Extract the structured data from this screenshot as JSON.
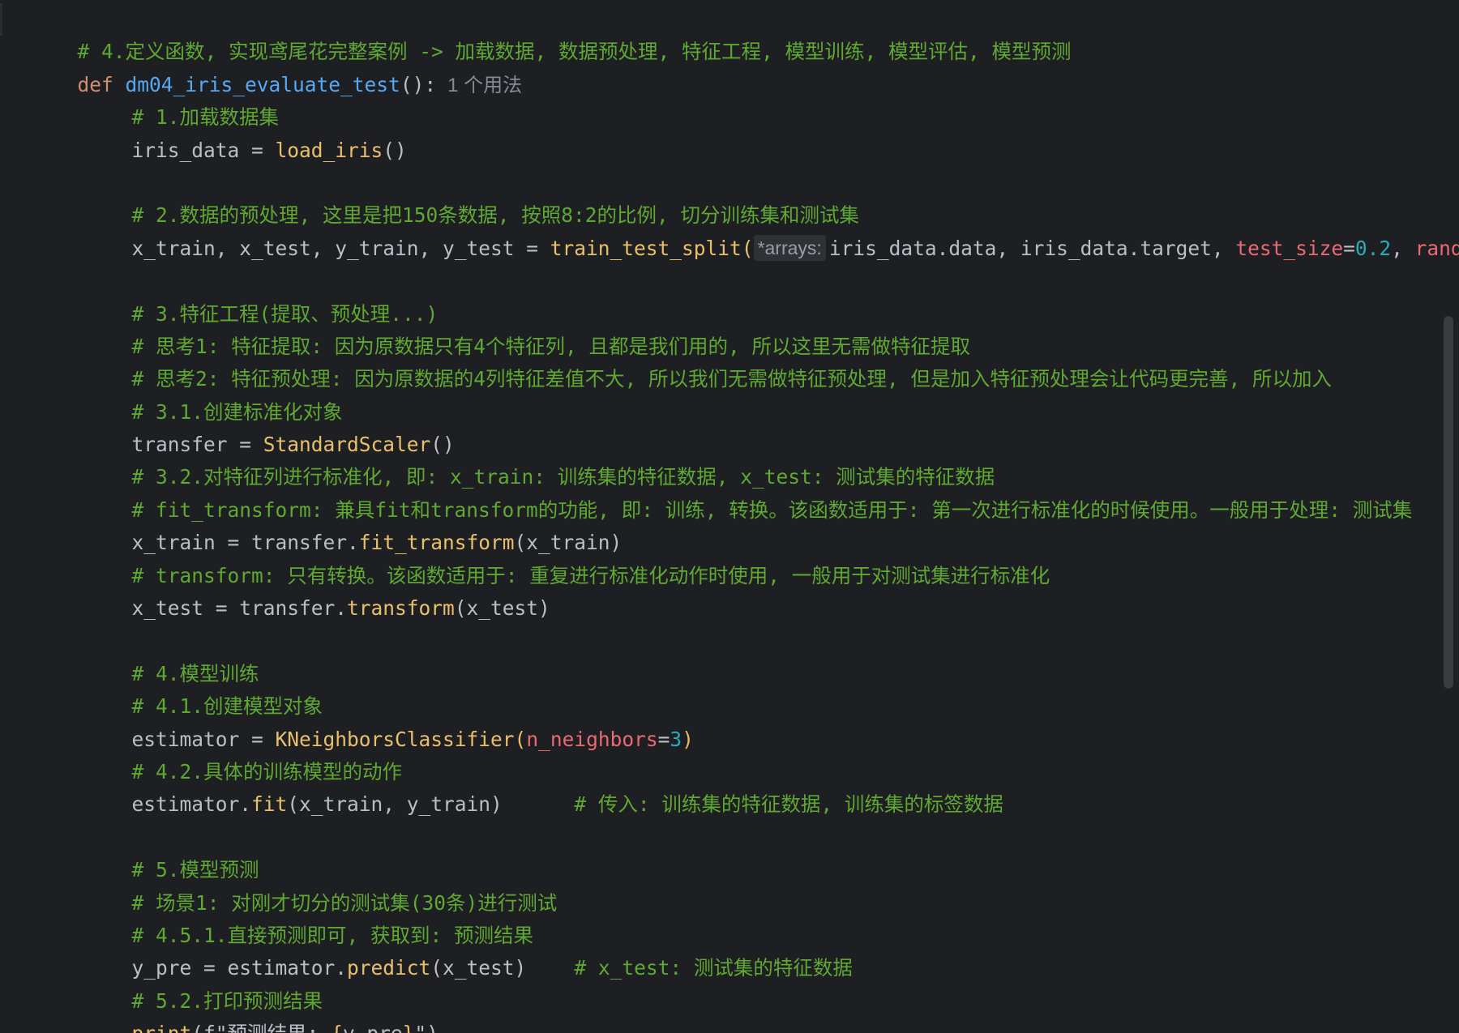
{
  "editor": {
    "language": "Python",
    "theme_colors": {
      "background": "#1e1f22",
      "comment": "#5fa832",
      "keyword": "#cf8e6d",
      "function": "#56a8f5",
      "call": "#e8c06b",
      "parameter": "#e96a72",
      "number": "#2aacb8",
      "text": "#bcbec4"
    },
    "lines": {
      "l1": "# 4.定义函数, 实现鸢尾花完整案例 -> 加载数据, 数据预处理, 特征工程, 模型训练, 模型评估, 模型预测",
      "l2_kw": "def",
      "l2_name": "dm04_iris_evaluate_test",
      "l2_tail": "():",
      "l2_usage": "1 个用法",
      "l3": "# 1.加载数据集",
      "l4_var": "iris_data = ",
      "l4_call": "load_iris",
      "l4_tail": "()",
      "l6": "# 2.数据的预处理, 这里是把150条数据, 按照8:2的比例, 切分训练集和测试集",
      "l7_var": "x_train, x_test, y_train, y_test = ",
      "l7_call": "train_test_split",
      "l7_open": "(",
      "l7_hint": "*arrays:",
      "l7_args": "iris_data.data, iris_data.target, ",
      "l7_kw1": "test_size",
      "l7_eq1": "=",
      "l7_num1": "0.2",
      "l7_comma": ", ",
      "l7_kw2": "random_",
      "l9": "# 3.特征工程(提取、预处理...)",
      "l10": "# 思考1: 特征提取: 因为原数据只有4个特征列, 且都是我们用的, 所以这里无需做特征提取",
      "l11": "# 思考2: 特征预处理: 因为原数据的4列特征差值不大, 所以我们无需做特征预处理, 但是加入特征预处理会让代码更完善, 所以加入",
      "l12": "# 3.1.创建标准化对象",
      "l13_var": "transfer = ",
      "l13_call": "StandardScaler",
      "l13_tail": "()",
      "l14": "# 3.2.对特征列进行标准化, 即: x_train: 训练集的特征数据, x_test: 测试集的特征数据",
      "l15": "# fit_transform: 兼具fit和transform的功能, 即: 训练, 转换。该函数适用于: 第一次进行标准化的时候使用。一般用于处理: 测试集",
      "l16_var": "x_train = transfer.",
      "l16_call": "fit_transform",
      "l16_tail": "(x_train)",
      "l17": "# transform: 只有转换。该函数适用于: 重复进行标准化动作时使用, 一般用于对测试集进行标准化",
      "l18_var": "x_test = transfer.",
      "l18_call": "transform",
      "l18_tail": "(x_test)",
      "l20": "# 4.模型训练",
      "l21": "# 4.1.创建模型对象",
      "l22_var": "estimator = ",
      "l22_call": "KNeighborsClassifier",
      "l22_open": "(",
      "l22_kw": "n_neighbors",
      "l22_eq": "=",
      "l22_num": "3",
      "l22_close": ")",
      "l23": "# 4.2.具体的训练模型的动作",
      "l24_var": "estimator.",
      "l24_call": "fit",
      "l24_tail": "(x_train, y_train)",
      "l24_gap": "      ",
      "l24_cm": "# 传入: 训练集的特征数据, 训练集的标签数据",
      "l26": "# 5.模型预测",
      "l27": "# 场景1: 对刚才切分的测试集(30条)进行测试",
      "l28": "# 4.5.1.直接预测即可, 获取到: 预测结果",
      "l29_var": "y_pre = estimator.",
      "l29_call": "predict",
      "l29_tail": "(x_test)",
      "l29_gap": "    ",
      "l29_cm": "# x_test: 测试集的特征数据",
      "l30": "# 5.2.打印预测结果",
      "l31_call": "print",
      "l31_open": "(f\"预测结果: ",
      "l31_brace_open": "{",
      "l31_var": "y_pre",
      "l31_brace_close": "}",
      "l31_close": "\")"
    }
  }
}
